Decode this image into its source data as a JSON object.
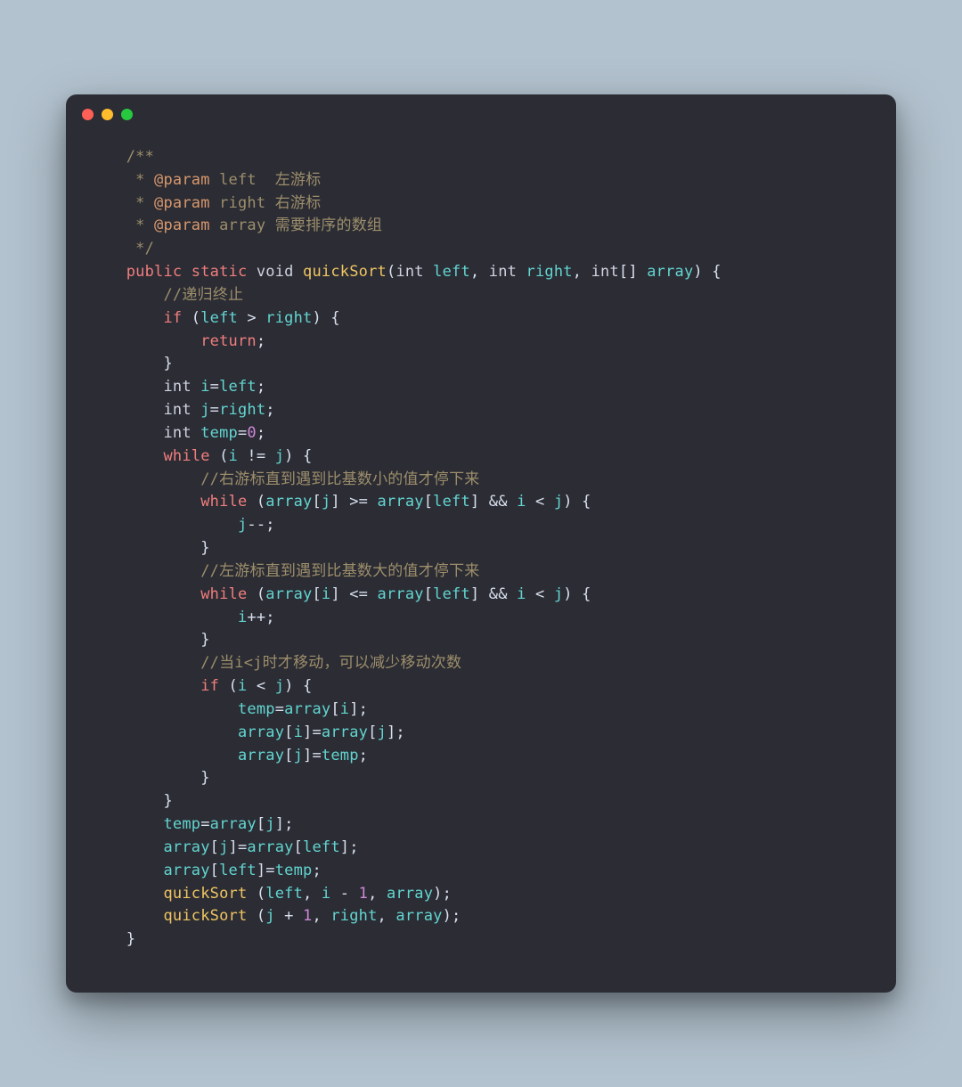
{
  "window": {
    "dots": [
      "red",
      "yellow",
      "green"
    ]
  },
  "code": {
    "lines": [
      [
        {
          "cls": "c-comment",
          "text": "    /**"
        }
      ],
      [
        {
          "cls": "c-comment",
          "text": "     * "
        },
        {
          "cls": "c-annotation",
          "text": "@param"
        },
        {
          "cls": "c-comment",
          "text": " left  左游标"
        }
      ],
      [
        {
          "cls": "c-comment",
          "text": "     * "
        },
        {
          "cls": "c-annotation",
          "text": "@param"
        },
        {
          "cls": "c-comment",
          "text": " right 右游标"
        }
      ],
      [
        {
          "cls": "c-comment",
          "text": "     * "
        },
        {
          "cls": "c-annotation",
          "text": "@param"
        },
        {
          "cls": "c-comment",
          "text": " array 需要排序的数组"
        }
      ],
      [
        {
          "cls": "c-comment",
          "text": "     */"
        }
      ],
      [
        {
          "cls": "c-text",
          "text": "    "
        },
        {
          "cls": "c-keyword",
          "text": "public"
        },
        {
          "cls": "c-text",
          "text": " "
        },
        {
          "cls": "c-keyword",
          "text": "static"
        },
        {
          "cls": "c-text",
          "text": " "
        },
        {
          "cls": "c-type",
          "text": "void"
        },
        {
          "cls": "c-text",
          "text": " "
        },
        {
          "cls": "c-funcname",
          "text": "quickSort"
        },
        {
          "cls": "c-text",
          "text": "("
        },
        {
          "cls": "c-type",
          "text": "int"
        },
        {
          "cls": "c-text",
          "text": " "
        },
        {
          "cls": "c-var",
          "text": "left"
        },
        {
          "cls": "c-text",
          "text": ", "
        },
        {
          "cls": "c-type",
          "text": "int"
        },
        {
          "cls": "c-text",
          "text": " "
        },
        {
          "cls": "c-var",
          "text": "right"
        },
        {
          "cls": "c-text",
          "text": ", "
        },
        {
          "cls": "c-type",
          "text": "int"
        },
        {
          "cls": "c-text",
          "text": "[] "
        },
        {
          "cls": "c-var",
          "text": "array"
        },
        {
          "cls": "c-text",
          "text": ") {"
        }
      ],
      [
        {
          "cls": "c-text",
          "text": "        "
        },
        {
          "cls": "c-comment",
          "text": "//递归终止"
        }
      ],
      [
        {
          "cls": "c-text",
          "text": "        "
        },
        {
          "cls": "c-keyword",
          "text": "if"
        },
        {
          "cls": "c-text",
          "text": " ("
        },
        {
          "cls": "c-var",
          "text": "left"
        },
        {
          "cls": "c-text",
          "text": " > "
        },
        {
          "cls": "c-var",
          "text": "right"
        },
        {
          "cls": "c-text",
          "text": ") {"
        }
      ],
      [
        {
          "cls": "c-text",
          "text": "            "
        },
        {
          "cls": "c-keyword",
          "text": "return"
        },
        {
          "cls": "c-text",
          "text": ";"
        }
      ],
      [
        {
          "cls": "c-text",
          "text": "        }"
        }
      ],
      [
        {
          "cls": "c-text",
          "text": "        "
        },
        {
          "cls": "c-type",
          "text": "int"
        },
        {
          "cls": "c-text",
          "text": " "
        },
        {
          "cls": "c-var",
          "text": "i"
        },
        {
          "cls": "c-text",
          "text": "="
        },
        {
          "cls": "c-var",
          "text": "left"
        },
        {
          "cls": "c-text",
          "text": ";"
        }
      ],
      [
        {
          "cls": "c-text",
          "text": "        "
        },
        {
          "cls": "c-type",
          "text": "int"
        },
        {
          "cls": "c-text",
          "text": " "
        },
        {
          "cls": "c-var",
          "text": "j"
        },
        {
          "cls": "c-text",
          "text": "="
        },
        {
          "cls": "c-var",
          "text": "right"
        },
        {
          "cls": "c-text",
          "text": ";"
        }
      ],
      [
        {
          "cls": "c-text",
          "text": "        "
        },
        {
          "cls": "c-type",
          "text": "int"
        },
        {
          "cls": "c-text",
          "text": " "
        },
        {
          "cls": "c-var",
          "text": "temp"
        },
        {
          "cls": "c-text",
          "text": "="
        },
        {
          "cls": "c-number",
          "text": "0"
        },
        {
          "cls": "c-text",
          "text": ";"
        }
      ],
      [
        {
          "cls": "c-text",
          "text": "        "
        },
        {
          "cls": "c-keyword",
          "text": "while"
        },
        {
          "cls": "c-text",
          "text": " ("
        },
        {
          "cls": "c-var",
          "text": "i"
        },
        {
          "cls": "c-text",
          "text": " != "
        },
        {
          "cls": "c-var",
          "text": "j"
        },
        {
          "cls": "c-text",
          "text": ") {"
        }
      ],
      [
        {
          "cls": "c-text",
          "text": "            "
        },
        {
          "cls": "c-comment",
          "text": "//右游标直到遇到比基数小的值才停下来"
        }
      ],
      [
        {
          "cls": "c-text",
          "text": "            "
        },
        {
          "cls": "c-keyword",
          "text": "while"
        },
        {
          "cls": "c-text",
          "text": " ("
        },
        {
          "cls": "c-var",
          "text": "array"
        },
        {
          "cls": "c-text",
          "text": "["
        },
        {
          "cls": "c-var",
          "text": "j"
        },
        {
          "cls": "c-text",
          "text": "] >= "
        },
        {
          "cls": "c-var",
          "text": "array"
        },
        {
          "cls": "c-text",
          "text": "["
        },
        {
          "cls": "c-var",
          "text": "left"
        },
        {
          "cls": "c-text",
          "text": "] && "
        },
        {
          "cls": "c-var",
          "text": "i"
        },
        {
          "cls": "c-text",
          "text": " < "
        },
        {
          "cls": "c-var",
          "text": "j"
        },
        {
          "cls": "c-text",
          "text": ") {"
        }
      ],
      [
        {
          "cls": "c-text",
          "text": "                "
        },
        {
          "cls": "c-var",
          "text": "j"
        },
        {
          "cls": "c-text",
          "text": "--;"
        }
      ],
      [
        {
          "cls": "c-text",
          "text": "            }"
        }
      ],
      [
        {
          "cls": "c-text",
          "text": "            "
        },
        {
          "cls": "c-comment",
          "text": "//左游标直到遇到比基数大的值才停下来"
        }
      ],
      [
        {
          "cls": "c-text",
          "text": "            "
        },
        {
          "cls": "c-keyword",
          "text": "while"
        },
        {
          "cls": "c-text",
          "text": " ("
        },
        {
          "cls": "c-var",
          "text": "array"
        },
        {
          "cls": "c-text",
          "text": "["
        },
        {
          "cls": "c-var",
          "text": "i"
        },
        {
          "cls": "c-text",
          "text": "] <= "
        },
        {
          "cls": "c-var",
          "text": "array"
        },
        {
          "cls": "c-text",
          "text": "["
        },
        {
          "cls": "c-var",
          "text": "left"
        },
        {
          "cls": "c-text",
          "text": "] && "
        },
        {
          "cls": "c-var",
          "text": "i"
        },
        {
          "cls": "c-text",
          "text": " < "
        },
        {
          "cls": "c-var",
          "text": "j"
        },
        {
          "cls": "c-text",
          "text": ") {"
        }
      ],
      [
        {
          "cls": "c-text",
          "text": "                "
        },
        {
          "cls": "c-var",
          "text": "i"
        },
        {
          "cls": "c-text",
          "text": "++;"
        }
      ],
      [
        {
          "cls": "c-text",
          "text": "            }"
        }
      ],
      [
        {
          "cls": "c-text",
          "text": "            "
        },
        {
          "cls": "c-comment",
          "text": "//当i<j时才移动，可以减少移动次数"
        }
      ],
      [
        {
          "cls": "c-text",
          "text": "            "
        },
        {
          "cls": "c-keyword",
          "text": "if"
        },
        {
          "cls": "c-text",
          "text": " ("
        },
        {
          "cls": "c-var",
          "text": "i"
        },
        {
          "cls": "c-text",
          "text": " < "
        },
        {
          "cls": "c-var",
          "text": "j"
        },
        {
          "cls": "c-text",
          "text": ") {"
        }
      ],
      [
        {
          "cls": "c-text",
          "text": "                "
        },
        {
          "cls": "c-var",
          "text": "temp"
        },
        {
          "cls": "c-text",
          "text": "="
        },
        {
          "cls": "c-var",
          "text": "array"
        },
        {
          "cls": "c-text",
          "text": "["
        },
        {
          "cls": "c-var",
          "text": "i"
        },
        {
          "cls": "c-text",
          "text": "];"
        }
      ],
      [
        {
          "cls": "c-text",
          "text": "                "
        },
        {
          "cls": "c-var",
          "text": "array"
        },
        {
          "cls": "c-text",
          "text": "["
        },
        {
          "cls": "c-var",
          "text": "i"
        },
        {
          "cls": "c-text",
          "text": "]="
        },
        {
          "cls": "c-var",
          "text": "array"
        },
        {
          "cls": "c-text",
          "text": "["
        },
        {
          "cls": "c-var",
          "text": "j"
        },
        {
          "cls": "c-text",
          "text": "];"
        }
      ],
      [
        {
          "cls": "c-text",
          "text": "                "
        },
        {
          "cls": "c-var",
          "text": "array"
        },
        {
          "cls": "c-text",
          "text": "["
        },
        {
          "cls": "c-var",
          "text": "j"
        },
        {
          "cls": "c-text",
          "text": "]="
        },
        {
          "cls": "c-var",
          "text": "temp"
        },
        {
          "cls": "c-text",
          "text": ";"
        }
      ],
      [
        {
          "cls": "c-text",
          "text": "            }"
        }
      ],
      [
        {
          "cls": "c-text",
          "text": "        }"
        }
      ],
      [
        {
          "cls": "c-text",
          "text": "        "
        },
        {
          "cls": "c-var",
          "text": "temp"
        },
        {
          "cls": "c-text",
          "text": "="
        },
        {
          "cls": "c-var",
          "text": "array"
        },
        {
          "cls": "c-text",
          "text": "["
        },
        {
          "cls": "c-var",
          "text": "j"
        },
        {
          "cls": "c-text",
          "text": "];"
        }
      ],
      [
        {
          "cls": "c-text",
          "text": "        "
        },
        {
          "cls": "c-var",
          "text": "array"
        },
        {
          "cls": "c-text",
          "text": "["
        },
        {
          "cls": "c-var",
          "text": "j"
        },
        {
          "cls": "c-text",
          "text": "]="
        },
        {
          "cls": "c-var",
          "text": "array"
        },
        {
          "cls": "c-text",
          "text": "["
        },
        {
          "cls": "c-var",
          "text": "left"
        },
        {
          "cls": "c-text",
          "text": "];"
        }
      ],
      [
        {
          "cls": "c-text",
          "text": "        "
        },
        {
          "cls": "c-var",
          "text": "array"
        },
        {
          "cls": "c-text",
          "text": "["
        },
        {
          "cls": "c-var",
          "text": "left"
        },
        {
          "cls": "c-text",
          "text": "]="
        },
        {
          "cls": "c-var",
          "text": "temp"
        },
        {
          "cls": "c-text",
          "text": ";"
        }
      ],
      [
        {
          "cls": "c-text",
          "text": "        "
        },
        {
          "cls": "c-funcname",
          "text": "quickSort"
        },
        {
          "cls": "c-text",
          "text": " ("
        },
        {
          "cls": "c-var",
          "text": "left"
        },
        {
          "cls": "c-text",
          "text": ", "
        },
        {
          "cls": "c-var",
          "text": "i"
        },
        {
          "cls": "c-text",
          "text": " - "
        },
        {
          "cls": "c-number",
          "text": "1"
        },
        {
          "cls": "c-text",
          "text": ", "
        },
        {
          "cls": "c-var",
          "text": "array"
        },
        {
          "cls": "c-text",
          "text": ");"
        }
      ],
      [
        {
          "cls": "c-text",
          "text": "        "
        },
        {
          "cls": "c-funcname",
          "text": "quickSort"
        },
        {
          "cls": "c-text",
          "text": " ("
        },
        {
          "cls": "c-var",
          "text": "j"
        },
        {
          "cls": "c-text",
          "text": " + "
        },
        {
          "cls": "c-number",
          "text": "1"
        },
        {
          "cls": "c-text",
          "text": ", "
        },
        {
          "cls": "c-var",
          "text": "right"
        },
        {
          "cls": "c-text",
          "text": ", "
        },
        {
          "cls": "c-var",
          "text": "array"
        },
        {
          "cls": "c-text",
          "text": ");"
        }
      ],
      [
        {
          "cls": "c-text",
          "text": "    }"
        }
      ]
    ]
  }
}
